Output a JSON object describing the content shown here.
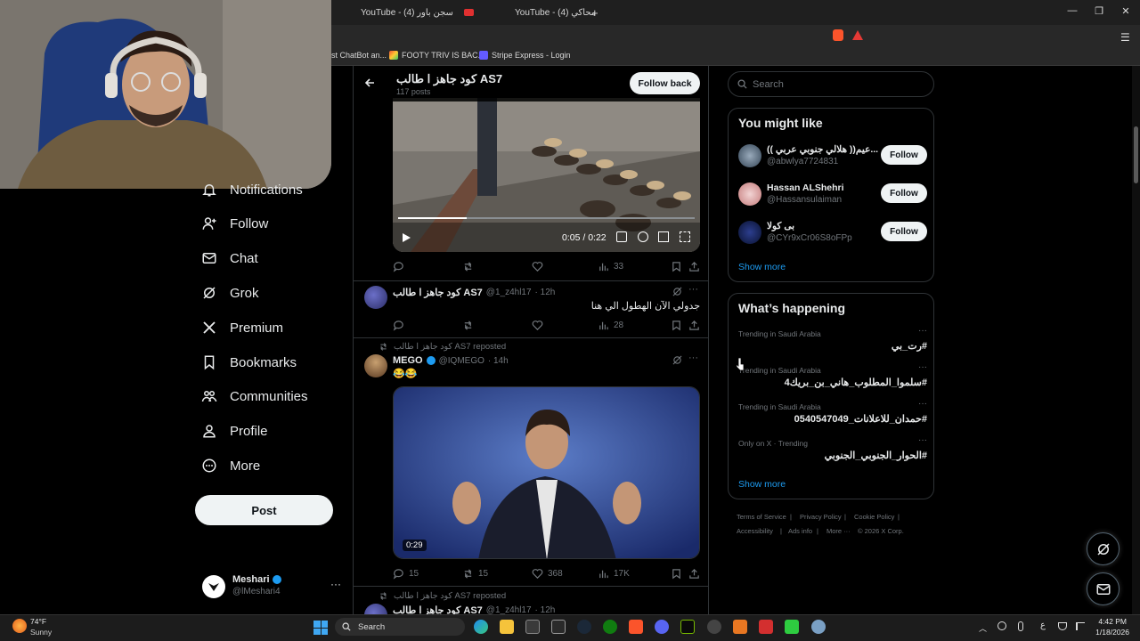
{
  "browser": {
    "tabs": [
      {
        "title": "YouTube - (4) سجن باور"
      },
      {
        "title": "YouTube - (4) محاكي"
      }
    ],
    "bookmarks": [
      {
        "label": "st ChatBot an..."
      },
      {
        "label": "FOOTY TRIV IS BAC..."
      },
      {
        "label": "Stripe Express - Login"
      }
    ]
  },
  "nav": {
    "items": [
      {
        "label": "Notifications",
        "icon": "bell-icon"
      },
      {
        "label": "Follow",
        "icon": "person-add-icon"
      },
      {
        "label": "Chat",
        "icon": "mail-icon"
      },
      {
        "label": "Grok",
        "icon": "grok-icon"
      },
      {
        "label": "Premium",
        "icon": "x-logo-icon"
      },
      {
        "label": "Bookmarks",
        "icon": "bookmark-icon"
      },
      {
        "label": "Communities",
        "icon": "communities-icon"
      },
      {
        "label": "Profile",
        "icon": "profile-icon"
      },
      {
        "label": "More",
        "icon": "more-circle-icon"
      }
    ],
    "post_label": "Post",
    "account": {
      "name": "Meshari",
      "handle": "@lMeshari4"
    }
  },
  "profile_header": {
    "title": "كود جاهز ا طالب AS7",
    "posts": "117 posts",
    "follow_back_label": "Follow back"
  },
  "posts": [
    {
      "video": {
        "time": "0:05 / 0:22"
      },
      "views": "33"
    },
    {
      "author": "كود جاهز ا طالب AS7",
      "handle": "@1_z4hl17",
      "time": "· 12h",
      "text": "جدولي الآن الهطول الي هنا",
      "views": "28"
    },
    {
      "repost_by": "كود جاهز ا طالب AS7 reposted",
      "author": "MEGO",
      "handle": "@IQMEGO",
      "time": "· 14h",
      "text": "😂😂",
      "video_duration": "0:29",
      "replies": "15",
      "reposts": "15",
      "likes": "368",
      "views": "17K"
    },
    {
      "repost_by": "كود جاهز ا طالب AS7 reposted",
      "author": "كود جاهز ا طالب AS7",
      "handle": "@1_z4hl17",
      "time": "· 12h"
    }
  ],
  "sidebar": {
    "search_placeholder": "Search",
    "you_might_like": {
      "title": "You might like",
      "users": [
        {
          "name": "(( هلالي جنوبي عربي ))عيم...",
          "handle": "@abwlya7724831",
          "follow": "Follow"
        },
        {
          "name": "Hassan ALShehri",
          "handle": "@Hassansulaiman",
          "follow": "Follow"
        },
        {
          "name": "بى كولا",
          "handle": "@CYr9xCr06S8oFPp",
          "follow": "Follow"
        }
      ],
      "show_more": "Show more"
    },
    "whats_happening": {
      "title": "What’s happening",
      "trends": [
        {
          "context": "Trending in Saudi Arabia",
          "topic": "#رت_بي"
        },
        {
          "context": "Trending in Saudi Arabia",
          "topic": "#سلموا_المطلوب_هاني_بن_بريك4"
        },
        {
          "context": "Trending in Saudi Arabia",
          "topic": "#حمدان_للاعلانات_0540547049"
        },
        {
          "context": "Only on X · Trending",
          "topic": "#الحوار_الجنوبي_الجنوبي"
        }
      ],
      "show_more": "Show more"
    },
    "footer": [
      "Terms of Service",
      "|",
      "Privacy Policy",
      "|",
      "Cookie Policy",
      "|",
      "Accessibility",
      "|",
      "Ads info",
      "|",
      "More ···",
      "© 2026 X Corp."
    ]
  },
  "taskbar": {
    "weather_temp": "74°F",
    "weather_desc": "Sunny",
    "search_label": "Search",
    "time": "4:42 PM",
    "date": "1/18/2026",
    "lang": "ع"
  },
  "colors": {
    "accent": "#1d9bf0",
    "bg": "#000000",
    "border": "#2f3336",
    "muted": "#71767b"
  }
}
